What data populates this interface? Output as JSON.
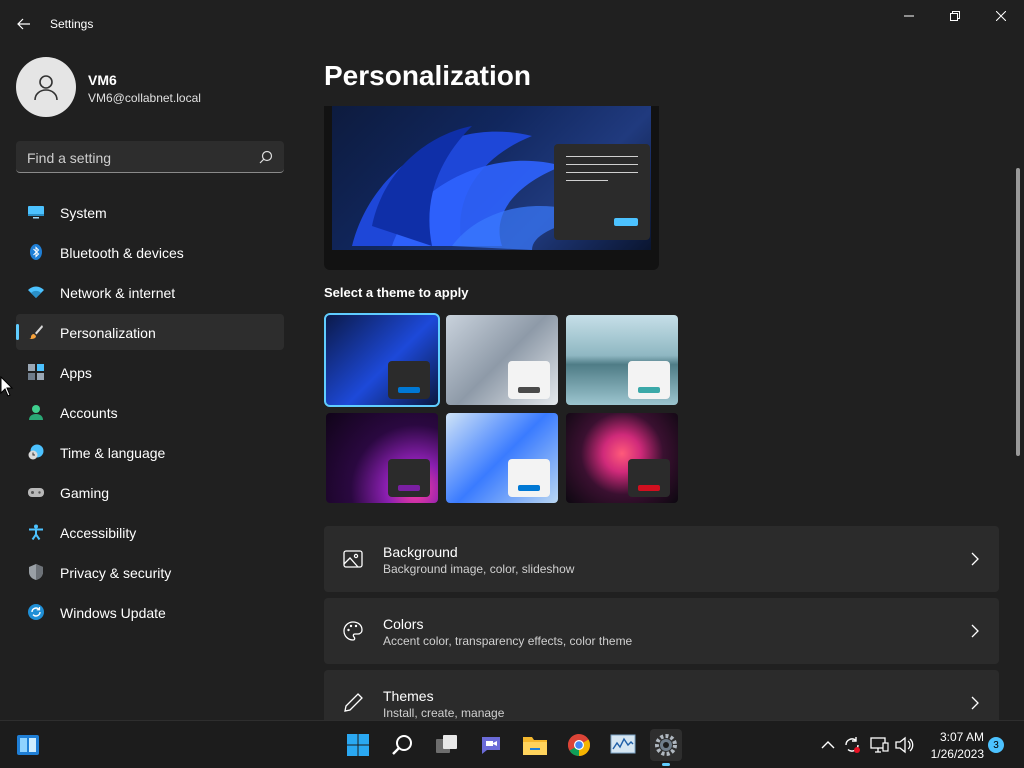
{
  "window": {
    "title": "Settings"
  },
  "user": {
    "name": "VM6",
    "email": "VM6@collabnet.local"
  },
  "search": {
    "placeholder": "Find a setting"
  },
  "sidebar": {
    "items": [
      {
        "label": "System",
        "icon": "monitor-icon"
      },
      {
        "label": "Bluetooth & devices",
        "icon": "bluetooth-icon"
      },
      {
        "label": "Network & internet",
        "icon": "wifi-icon"
      },
      {
        "label": "Personalization",
        "icon": "brush-icon",
        "selected": true
      },
      {
        "label": "Apps",
        "icon": "apps-icon"
      },
      {
        "label": "Accounts",
        "icon": "person-icon"
      },
      {
        "label": "Time & language",
        "icon": "clock-globe-icon"
      },
      {
        "label": "Gaming",
        "icon": "gamepad-icon"
      },
      {
        "label": "Accessibility",
        "icon": "accessibility-icon"
      },
      {
        "label": "Privacy & security",
        "icon": "shield-icon"
      },
      {
        "label": "Windows Update",
        "icon": "update-icon"
      }
    ]
  },
  "main": {
    "title": "Personalization",
    "themes_label": "Select a theme to apply",
    "themes": [
      {
        "name": "windows-dark",
        "accent": "#0078d4",
        "swatch": "#2b2b2b",
        "selected": true
      },
      {
        "name": "glow-light",
        "accent": "#4a4a4a",
        "swatch": "#f3f3f3"
      },
      {
        "name": "captured-motion",
        "accent": "#3aa8a8",
        "swatch": "#f3f3f3"
      },
      {
        "name": "sunrise-purple",
        "accent": "#7a1fa2",
        "swatch": "#2b2b2b"
      },
      {
        "name": "windows-light",
        "accent": "#0078d4",
        "swatch": "#f3f3f3"
      },
      {
        "name": "flow-red",
        "accent": "#d10f1f",
        "swatch": "#2b2b2b"
      }
    ],
    "cards": [
      {
        "title": "Background",
        "subtitle": "Background image, color, slideshow",
        "icon": "picture-icon"
      },
      {
        "title": "Colors",
        "subtitle": "Accent color, transparency effects, color theme",
        "icon": "palette-icon"
      },
      {
        "title": "Themes",
        "subtitle": "Install, create, manage",
        "icon": "pen-icon"
      }
    ]
  },
  "taskbar": {
    "apps": [
      {
        "icon": "start-icon"
      },
      {
        "icon": "search-icon"
      },
      {
        "icon": "task-view-icon"
      },
      {
        "icon": "teams-chat-icon"
      },
      {
        "icon": "file-explorer-icon"
      },
      {
        "icon": "chrome-icon"
      },
      {
        "icon": "performance-monitor-icon"
      },
      {
        "icon": "settings-gear-icon",
        "active": true
      }
    ],
    "clock": {
      "time": "3:07 AM",
      "date": "1/26/2023"
    },
    "notifications": "3"
  },
  "colors": {
    "accent": "#60cdff",
    "background": "#202020",
    "card": "#2b2b2b"
  }
}
